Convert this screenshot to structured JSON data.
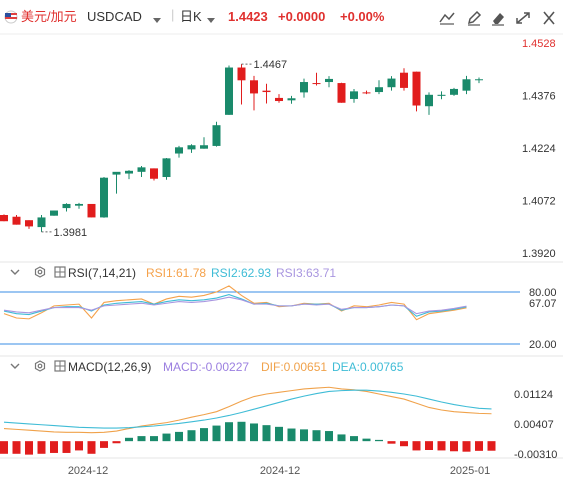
{
  "header": {
    "flag_icon": "us-ca-flag-icon",
    "pair_name": "美元/加元",
    "symbol": "USDCAD",
    "symbol_dropdown_icon": "caret-down-icon",
    "timeframe": "日K",
    "timeframe_dropdown_icon": "caret-down-icon",
    "price": "1.4423",
    "change": "+0.0000",
    "change_pct": "+0.00%",
    "colors": {
      "up": "#1a8a6b",
      "down": "#e11d1d",
      "price_red": "#e0312f",
      "pair": "#e0312f"
    },
    "tools": [
      {
        "icon": "line-tool-icon"
      },
      {
        "icon": "pencil-icon"
      },
      {
        "icon": "eraser-icon"
      },
      {
        "icon": "expand-icon"
      },
      {
        "icon": "close-icon"
      }
    ]
  },
  "chart_data": [
    {
      "type": "candlestick",
      "ylim": [
        1.392,
        1.4528
      ],
      "y_ticks": [
        "1.4528",
        "1.4376",
        "1.4224",
        "1.4072",
        "1.3920"
      ],
      "annotations": [
        {
          "label": "1.4467"
        },
        {
          "label": "1.3981"
        }
      ],
      "candles": [
        {
          "o": 1.403,
          "h": 1.4032,
          "l": 1.4012,
          "c": 1.4012
        },
        {
          "o": 1.4025,
          "h": 1.403,
          "l": 1.4002,
          "c": 1.4002
        },
        {
          "o": 1.4015,
          "h": 1.4015,
          "l": 1.399,
          "c": 1.3997
        },
        {
          "o": 1.3995,
          "h": 1.403,
          "l": 1.3981,
          "c": 1.4023
        },
        {
          "o": 1.4028,
          "h": 1.4043,
          "l": 1.4028,
          "c": 1.4043
        },
        {
          "o": 1.405,
          "h": 1.4064,
          "l": 1.404,
          "c": 1.4062
        },
        {
          "o": 1.4057,
          "h": 1.4065,
          "l": 1.4048,
          "c": 1.4062
        },
        {
          "o": 1.4062,
          "h": 1.4062,
          "l": 1.4023,
          "c": 1.4023
        },
        {
          "o": 1.4023,
          "h": 1.414,
          "l": 1.4022,
          "c": 1.4138
        },
        {
          "o": 1.4147,
          "h": 1.4154,
          "l": 1.4092,
          "c": 1.4155
        },
        {
          "o": 1.415,
          "h": 1.416,
          "l": 1.4134,
          "c": 1.4158
        },
        {
          "o": 1.4155,
          "h": 1.4172,
          "l": 1.414,
          "c": 1.4168
        },
        {
          "o": 1.4165,
          "h": 1.4165,
          "l": 1.413,
          "c": 1.4135
        },
        {
          "o": 1.414,
          "h": 1.4195,
          "l": 1.4132,
          "c": 1.4194
        },
        {
          "o": 1.4208,
          "h": 1.423,
          "l": 1.4196,
          "c": 1.4226
        },
        {
          "o": 1.422,
          "h": 1.4235,
          "l": 1.421,
          "c": 1.4232
        },
        {
          "o": 1.4222,
          "h": 1.4255,
          "l": 1.4222,
          "c": 1.4232
        },
        {
          "o": 1.423,
          "h": 1.43,
          "l": 1.4228,
          "c": 1.429
        },
        {
          "o": 1.432,
          "h": 1.4463,
          "l": 1.432,
          "c": 1.4457
        },
        {
          "o": 1.4457,
          "h": 1.4467,
          "l": 1.435,
          "c": 1.442
        },
        {
          "o": 1.442,
          "h": 1.4433,
          "l": 1.4333,
          "c": 1.4382
        },
        {
          "o": 1.439,
          "h": 1.441,
          "l": 1.4353,
          "c": 1.4386
        },
        {
          "o": 1.4369,
          "h": 1.438,
          "l": 1.4355,
          "c": 1.436
        },
        {
          "o": 1.4362,
          "h": 1.4375,
          "l": 1.4352,
          "c": 1.4368
        },
        {
          "o": 1.4385,
          "h": 1.4425,
          "l": 1.437,
          "c": 1.4415
        },
        {
          "o": 1.4412,
          "h": 1.4442,
          "l": 1.4405,
          "c": 1.441
        },
        {
          "o": 1.4415,
          "h": 1.4432,
          "l": 1.44,
          "c": 1.4424
        },
        {
          "o": 1.4412,
          "h": 1.4413,
          "l": 1.4355,
          "c": 1.4355
        },
        {
          "o": 1.4366,
          "h": 1.4395,
          "l": 1.4355,
          "c": 1.4388
        },
        {
          "o": 1.4385,
          "h": 1.439,
          "l": 1.438,
          "c": 1.4384
        },
        {
          "o": 1.4386,
          "h": 1.442,
          "l": 1.438,
          "c": 1.44
        },
        {
          "o": 1.44,
          "h": 1.4432,
          "l": 1.439,
          "c": 1.4425
        },
        {
          "o": 1.4442,
          "h": 1.4455,
          "l": 1.439,
          "c": 1.4398
        },
        {
          "o": 1.4445,
          "h": 1.4445,
          "l": 1.433,
          "c": 1.4347
        },
        {
          "o": 1.4345,
          "h": 1.4385,
          "l": 1.432,
          "c": 1.4378
        },
        {
          "o": 1.4375,
          "h": 1.4388,
          "l": 1.4365,
          "c": 1.4378
        },
        {
          "o": 1.4378,
          "h": 1.4398,
          "l": 1.4375,
          "c": 1.4395
        },
        {
          "o": 1.439,
          "h": 1.4433,
          "l": 1.438,
          "c": 1.4423
        },
        {
          "o": 1.4423,
          "h": 1.4428,
          "l": 1.4412,
          "c": 1.4423
        }
      ]
    },
    {
      "type": "line",
      "indicator": "RSI(7,14,21)",
      "ylim": [
        20.0,
        80.0
      ],
      "y_ticks": [
        "80.00",
        "67.07",
        "20.00"
      ],
      "reference_levels": [
        80,
        20
      ],
      "series": [
        {
          "name": "RSI1:61.78",
          "color": "#f5a24b",
          "values": [
            55,
            50,
            49,
            56,
            64,
            65,
            66,
            50,
            68,
            70,
            71,
            72,
            66,
            72,
            75,
            74,
            76,
            80,
            87,
            76,
            67,
            68,
            63,
            64,
            67,
            66,
            67,
            58,
            64,
            63,
            65,
            68,
            66,
            48,
            55,
            57,
            59,
            61.78
          ]
        },
        {
          "name": "RSI2:62.93",
          "color": "#3fbcd6",
          "values": [
            58,
            55,
            54,
            58,
            62,
            63,
            63,
            58,
            65,
            67,
            68,
            69,
            66,
            69,
            71,
            70,
            71,
            73,
            77,
            72,
            66,
            67,
            64,
            64,
            66,
            66,
            66,
            59,
            62,
            62,
            63,
            65,
            64,
            52,
            57,
            58,
            60,
            62.93
          ]
        },
        {
          "name": "RSI3:63.71",
          "color": "#a996e0",
          "values": [
            59,
            57,
            56,
            59,
            62,
            62,
            62,
            59,
            64,
            65,
            66,
            67,
            65,
            67,
            69,
            68,
            69,
            71,
            74,
            71,
            66,
            66,
            64,
            64,
            66,
            65,
            66,
            60,
            62,
            62,
            63,
            65,
            64,
            55,
            58,
            59,
            61,
            63.71
          ]
        }
      ]
    },
    {
      "type": "bar",
      "indicator": "MACD(12,26,9)",
      "ylim": [
        -0.004,
        0.015
      ],
      "y_ticks": [
        "0.01124",
        "0.00407",
        "-0.00310"
      ],
      "x_tick_labels": [
        "2024-12",
        "2024-12",
        "2025-01"
      ],
      "series": [
        {
          "name": "MACD:-0.00227",
          "color": "#f0a24b",
          "values": [
            -0.003,
            -0.003,
            -0.0032,
            -0.003,
            -0.0028,
            -0.0028,
            -0.0022,
            -0.003,
            -0.0016,
            -0.0005,
            0.0008,
            0.0012,
            0.0012,
            0.0018,
            0.0022,
            0.0026,
            0.0031,
            0.0037,
            0.0045,
            0.0046,
            0.0042,
            0.0038,
            0.0034,
            0.003,
            0.0028,
            0.0026,
            0.0024,
            0.0016,
            0.0012,
            0.0006,
            0.0003,
            -0.0006,
            -0.0012,
            -0.0022,
            -0.0021,
            -0.0022,
            -0.0024,
            -0.0025,
            -0.0023,
            -0.00227
          ]
        },
        {
          "name": "DIF:0.00651",
          "color": "#f0a24b",
          "values": [
            0.003,
            0.0028,
            0.0026,
            0.0024,
            0.0022,
            0.0021,
            0.0021,
            0.002,
            0.0021,
            0.0024,
            0.003,
            0.0036,
            0.004,
            0.0044,
            0.005,
            0.0057,
            0.0063,
            0.007,
            0.0082,
            0.0095,
            0.0106,
            0.0112,
            0.0116,
            0.012,
            0.0124,
            0.0126,
            0.0128,
            0.0124,
            0.0122,
            0.0118,
            0.0112,
            0.0106,
            0.01,
            0.009,
            0.008,
            0.0074,
            0.007,
            0.0068,
            0.0066,
            0.00651
          ]
        },
        {
          "name": "DEA:0.00765",
          "color": "#3fbcd6",
          "values": [
            0.0045,
            0.0043,
            0.0041,
            0.0039,
            0.0037,
            0.0035,
            0.0033,
            0.0032,
            0.0031,
            0.0031,
            0.0032,
            0.0034,
            0.0036,
            0.0039,
            0.0042,
            0.0046,
            0.005,
            0.0055,
            0.0061,
            0.0068,
            0.0076,
            0.0084,
            0.0092,
            0.01,
            0.0107,
            0.0113,
            0.0118,
            0.012,
            0.0121,
            0.0121,
            0.0119,
            0.0116,
            0.0112,
            0.0107,
            0.01,
            0.0093,
            0.0087,
            0.0082,
            0.0078,
            0.00765
          ]
        }
      ]
    }
  ],
  "rsi_header": {
    "label": "RSI(7,14,21)"
  },
  "macd_header": {
    "label": "MACD(12,26,9)"
  }
}
